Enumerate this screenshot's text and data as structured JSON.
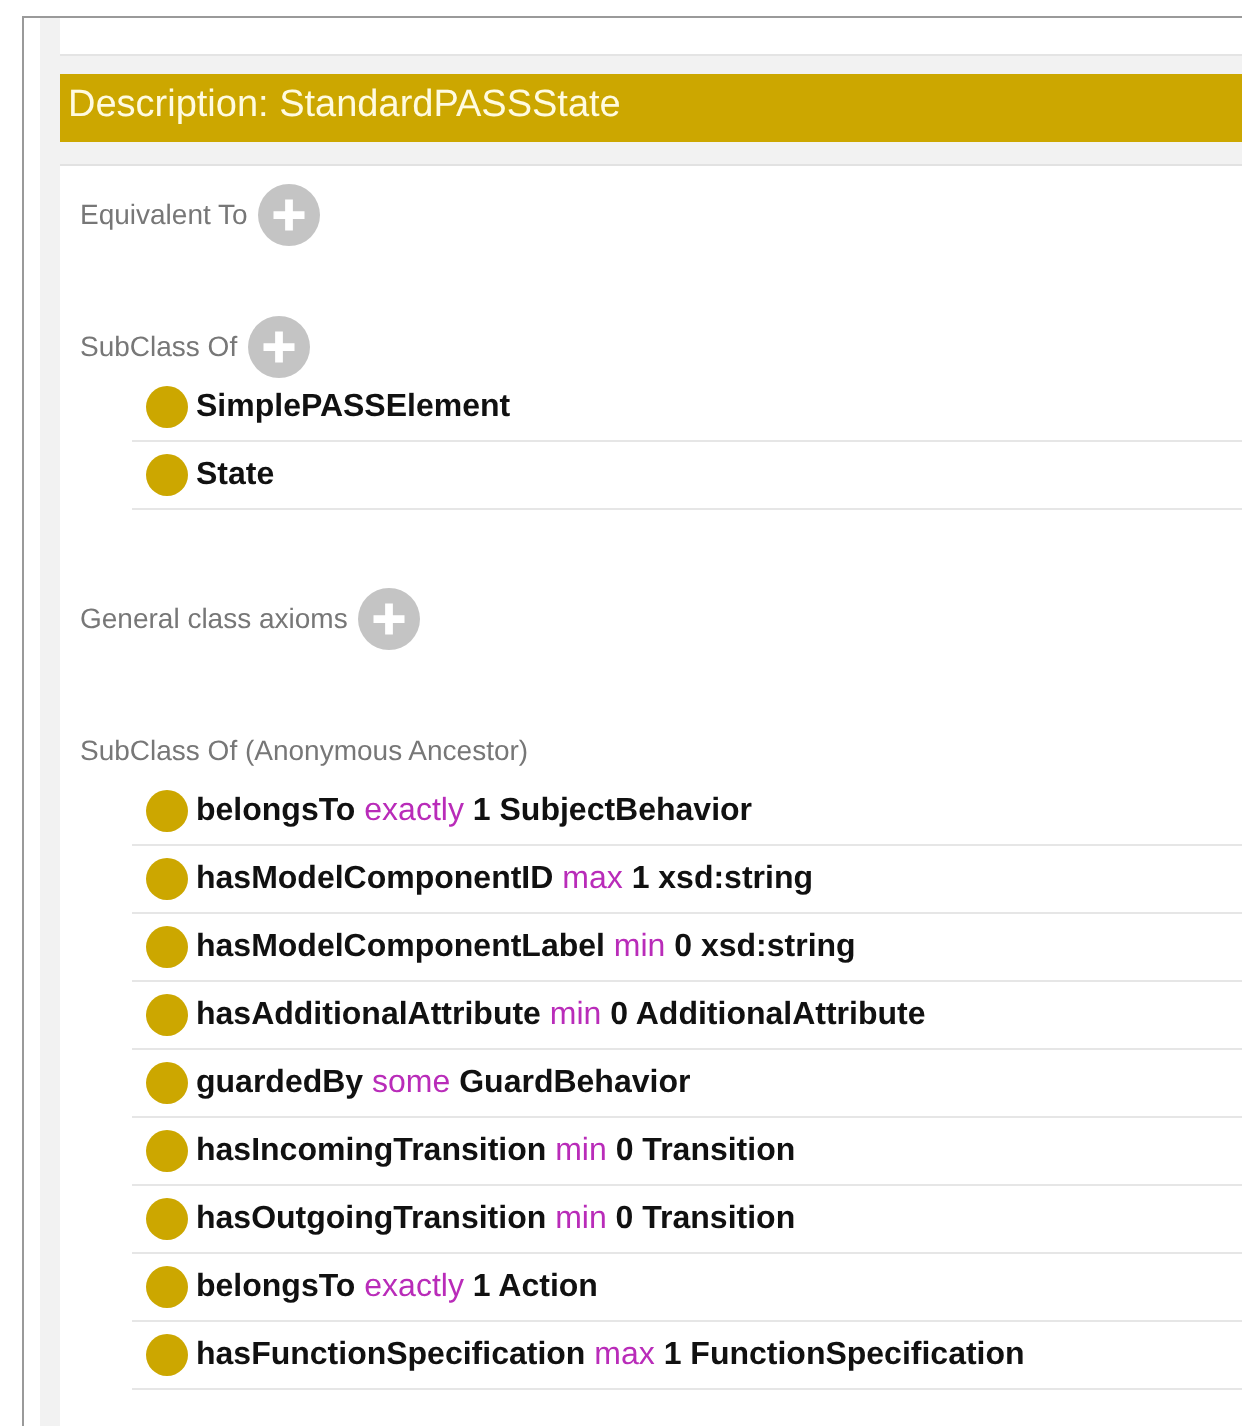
{
  "title": "Description: StandardPASSState",
  "sections": [
    {
      "label": "Equivalent To",
      "add_button": true
    },
    {
      "label": "SubClass Of",
      "add_button": true,
      "items": [
        {
          "property": "SimplePASSElement"
        },
        {
          "property": "State"
        }
      ]
    },
    {
      "label": "General class axioms",
      "add_button": true
    },
    {
      "label": "SubClass Of (Anonymous Ancestor)",
      "add_button": false,
      "items": [
        {
          "property": "belongsTo",
          "keyword": "exactly",
          "filler": "1 SubjectBehavior"
        },
        {
          "property": "hasModelComponentID",
          "keyword": "max",
          "filler": "1 xsd:string"
        },
        {
          "property": "hasModelComponentLabel",
          "keyword": "min",
          "filler": "0 xsd:string"
        },
        {
          "property": "hasAdditionalAttribute",
          "keyword": "min",
          "filler": "0 AdditionalAttribute"
        },
        {
          "property": "guardedBy",
          "keyword": "some",
          "filler": "GuardBehavior"
        },
        {
          "property": "hasIncomingTransition",
          "keyword": "min",
          "filler": "0 Transition"
        },
        {
          "property": "hasOutgoingTransition",
          "keyword": "min",
          "filler": "0 Transition"
        },
        {
          "property": "belongsTo",
          "keyword": "exactly",
          "filler": "1 Action"
        },
        {
          "property": "hasFunctionSpecification",
          "keyword": "max",
          "filler": "1 FunctionSpecification"
        }
      ]
    }
  ]
}
